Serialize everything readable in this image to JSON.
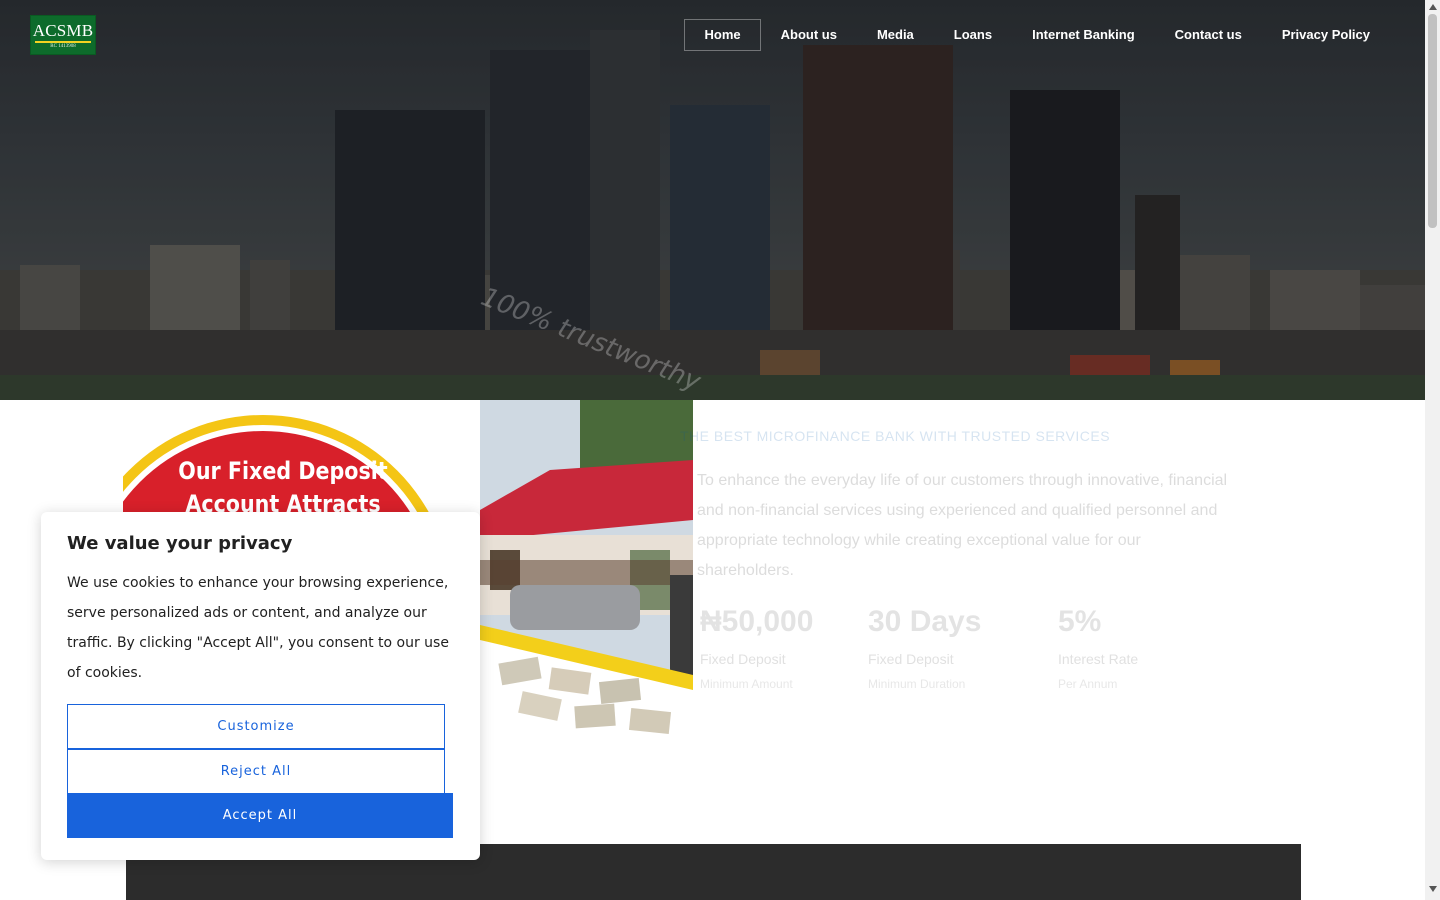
{
  "logo": {
    "text": "ACSMB",
    "subtext": "RC 1413908"
  },
  "nav": {
    "items": [
      {
        "label": "Home",
        "active": true
      },
      {
        "label": "About us"
      },
      {
        "label": "Media"
      },
      {
        "label": "Loans"
      },
      {
        "label": "Internet Banking"
      },
      {
        "label": "Contact us"
      },
      {
        "label": "Privacy Policy"
      }
    ]
  },
  "hero": {
    "tagline": "100% trustworthy"
  },
  "promo": {
    "headline_line1": "Our Fixed Deposit",
    "headline_line2": "Account Attracts Higher"
  },
  "intro": {
    "heading": "THE BEST MICROFINANCE BANK WITH TRUSTED SERVICES",
    "text": "To enhance the everyday life of our customers through innovative, financial and non-financial services using experienced and qualified personnel and appropriate technology while creating exceptional value for our shareholders."
  },
  "stats": [
    {
      "value": "₦50,000",
      "label": "Fixed Deposit",
      "sub": "Minimum Amount"
    },
    {
      "value": "30 Days",
      "label": "Fixed Deposit",
      "sub": "Minimum Duration"
    },
    {
      "value": "5%",
      "label": "Interest Rate",
      "sub": "Per Annum"
    }
  ],
  "cookie_banner": {
    "title": "We value your privacy",
    "body": "We use cookies to enhance your browsing experience, serve personalized ads or content, and analyze our traffic. By clicking \"Accept All\", you consent to our use of cookies.",
    "customize_label": "Customize",
    "reject_label": "Reject All",
    "accept_label": "Accept All"
  },
  "colors": {
    "accent": "#1863dc",
    "brand_green": "#0d6b2b",
    "brand_yellow": "#f3d321",
    "promo_red": "#d8202a"
  }
}
